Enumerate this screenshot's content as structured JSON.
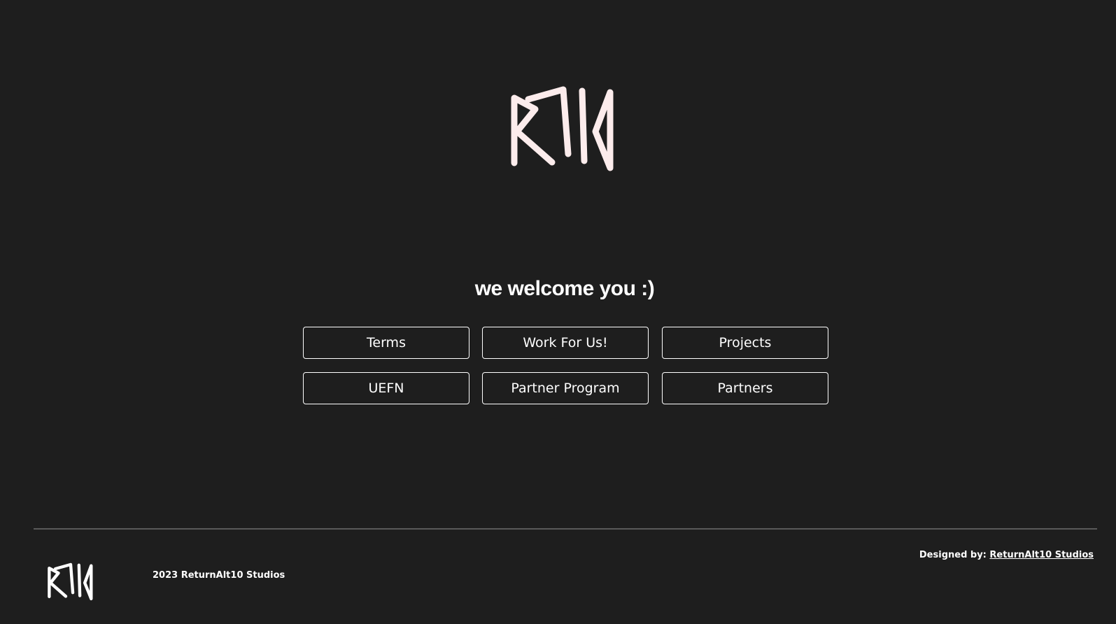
{
  "hero": {
    "logo_icon": "rat-monogram-logo-icon",
    "welcome_text": "we welcome you :)"
  },
  "nav": {
    "buttons": [
      {
        "label": "Terms"
      },
      {
        "label": "Work For Us!"
      },
      {
        "label": "Projects"
      },
      {
        "label": "UEFN"
      },
      {
        "label": "Partner Program"
      },
      {
        "label": "Partners"
      }
    ]
  },
  "footer": {
    "logo_icon": "rat-monogram-logo-icon",
    "copyright": "2023 ReturnAlt10 Studios",
    "designed_by_label": "Designed by:",
    "designed_by_link": "ReturnAlt10 Studios"
  },
  "colors": {
    "background": "#1e1e1e",
    "text": "#ffffff",
    "logo": "#fcecec",
    "divider": "#5a5a5a"
  }
}
